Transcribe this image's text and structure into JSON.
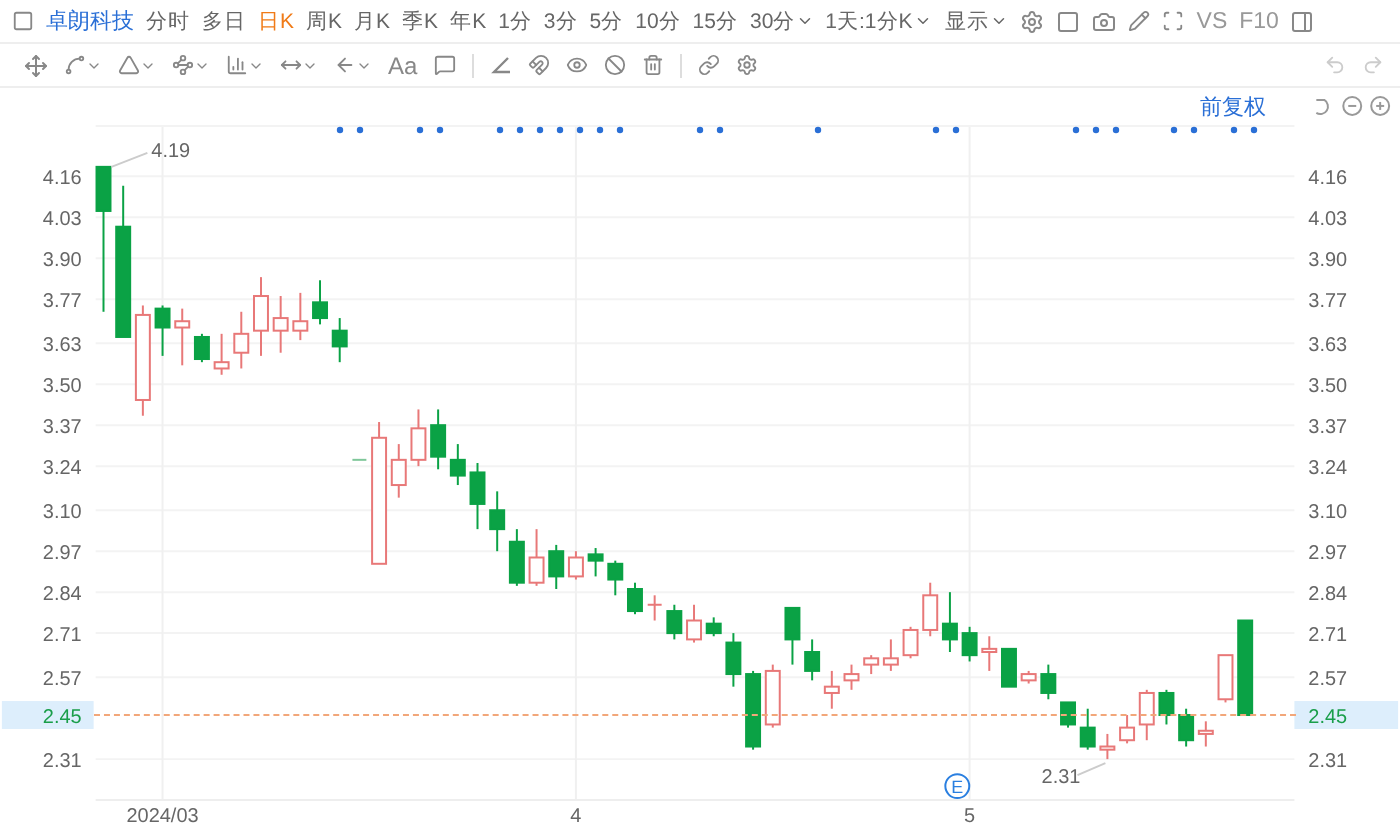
{
  "header": {
    "stock_name": "卓朗科技",
    "periods": [
      {
        "label": "分时",
        "selected": false,
        "kind": "plain"
      },
      {
        "label": "多日",
        "selected": false,
        "kind": "plain"
      },
      {
        "label": "日K",
        "selected": true,
        "kind": "plain"
      },
      {
        "label": "周K",
        "selected": false,
        "kind": "plain"
      },
      {
        "label": "月K",
        "selected": false,
        "kind": "plain"
      },
      {
        "label": "季K",
        "selected": false,
        "kind": "plain"
      },
      {
        "label": "年K",
        "selected": false,
        "kind": "plain"
      },
      {
        "label": "1分",
        "selected": false,
        "kind": "plain"
      },
      {
        "label": "3分",
        "selected": false,
        "kind": "plain"
      },
      {
        "label": "5分",
        "selected": false,
        "kind": "plain"
      },
      {
        "label": "10分",
        "selected": false,
        "kind": "plain"
      },
      {
        "label": "15分",
        "selected": false,
        "kind": "plain"
      },
      {
        "label": "30分",
        "selected": false,
        "kind": "dropdown"
      }
    ],
    "cycle_select": "1天:1分K",
    "display_menu": "显示",
    "compare": "VS",
    "f10": "F10"
  },
  "drawing_toolbar": {
    "text_tool": "Aa"
  },
  "chart": {
    "adjust_mode": "前复权",
    "left_axis": {
      "current_price": "2.45"
    },
    "right_axis": {
      "ticks": [
        "4.16",
        "4.03",
        "3.90",
        "3.77",
        "3.63",
        "3.50",
        "3.37",
        "3.24",
        "3.10",
        "2.97",
        "2.84",
        "2.71",
        "2.57",
        "2.31"
      ],
      "current_price": "2.45"
    },
    "high_label": "4.19",
    "low_label": "2.31",
    "event_marker": "E",
    "chart_data": {
      "type": "candlestick",
      "categories": [
        null,
        null,
        null,
        "2024/03",
        null,
        null,
        null,
        null,
        null,
        null,
        null,
        null,
        null,
        null,
        null,
        null,
        null,
        null,
        null,
        null,
        null,
        null,
        null,
        null,
        "4",
        null,
        null,
        null,
        null,
        null,
        null,
        null,
        null,
        null,
        null,
        null,
        null,
        null,
        null,
        null,
        null,
        null,
        null,
        null,
        "5",
        null,
        null,
        null,
        null,
        null,
        null,
        null,
        null,
        null,
        null,
        null,
        null,
        null,
        null
      ],
      "ohlc": [
        [
          4.19,
          4.19,
          3.73,
          4.05
        ],
        [
          4.0,
          4.13,
          3.65,
          3.65
        ],
        [
          3.45,
          3.75,
          3.4,
          3.72
        ],
        [
          3.74,
          3.75,
          3.59,
          3.68
        ],
        [
          3.68,
          3.74,
          3.56,
          3.7
        ],
        [
          3.65,
          3.66,
          3.57,
          3.58
        ],
        [
          3.55,
          3.66,
          3.53,
          3.57
        ],
        [
          3.6,
          3.73,
          3.55,
          3.66
        ],
        [
          3.67,
          3.84,
          3.59,
          3.78
        ],
        [
          3.67,
          3.78,
          3.6,
          3.71
        ],
        [
          3.67,
          3.79,
          3.64,
          3.7
        ],
        [
          3.76,
          3.83,
          3.69,
          3.71
        ],
        [
          3.67,
          3.71,
          3.57,
          3.62
        ],
        [
          3.26,
          3.26,
          3.26,
          3.26
        ],
        [
          2.93,
          3.38,
          2.93,
          3.33
        ],
        [
          3.18,
          3.31,
          3.14,
          3.26
        ],
        [
          3.26,
          3.42,
          3.24,
          3.36
        ],
        [
          3.37,
          3.42,
          3.23,
          3.27
        ],
        [
          3.26,
          3.31,
          3.18,
          3.21
        ],
        [
          3.22,
          3.25,
          3.04,
          3.12
        ],
        [
          3.1,
          3.16,
          2.97,
          3.04
        ],
        [
          3.0,
          3.04,
          2.86,
          2.87
        ],
        [
          2.87,
          3.04,
          2.86,
          2.95
        ],
        [
          2.97,
          2.99,
          2.85,
          2.89
        ],
        [
          2.89,
          2.97,
          2.88,
          2.95
        ],
        [
          2.96,
          2.98,
          2.89,
          2.94
        ],
        [
          2.93,
          2.94,
          2.83,
          2.88
        ],
        [
          2.85,
          2.87,
          2.77,
          2.78
        ],
        [
          2.8,
          2.83,
          2.75,
          2.8
        ],
        [
          2.78,
          2.8,
          2.69,
          2.71
        ],
        [
          2.69,
          2.8,
          2.68,
          2.75
        ],
        [
          2.74,
          2.76,
          2.7,
          2.71
        ],
        [
          2.68,
          2.71,
          2.54,
          2.58
        ],
        [
          2.58,
          2.59,
          2.34,
          2.35
        ],
        [
          2.42,
          2.61,
          2.41,
          2.59
        ],
        [
          2.79,
          2.79,
          2.61,
          2.69
        ],
        [
          2.65,
          2.69,
          2.56,
          2.59
        ],
        [
          2.52,
          2.59,
          2.47,
          2.54
        ],
        [
          2.56,
          2.61,
          2.53,
          2.58
        ],
        [
          2.61,
          2.64,
          2.58,
          2.63
        ],
        [
          2.61,
          2.69,
          2.59,
          2.63
        ],
        [
          2.64,
          2.73,
          2.63,
          2.72
        ],
        [
          2.72,
          2.87,
          2.7,
          2.83
        ],
        [
          2.74,
          2.84,
          2.65,
          2.69
        ],
        [
          2.71,
          2.73,
          2.62,
          2.64
        ],
        [
          2.65,
          2.7,
          2.59,
          2.66
        ],
        [
          2.66,
          2.66,
          2.54,
          2.54
        ],
        [
          2.56,
          2.59,
          2.55,
          2.58
        ],
        [
          2.58,
          2.61,
          2.5,
          2.52
        ],
        [
          2.49,
          2.49,
          2.41,
          2.42
        ],
        [
          2.41,
          2.47,
          2.34,
          2.35
        ],
        [
          2.34,
          2.39,
          2.31,
          2.35
        ],
        [
          2.37,
          2.45,
          2.36,
          2.41
        ],
        [
          2.42,
          2.53,
          2.37,
          2.52
        ],
        [
          2.52,
          2.53,
          2.42,
          2.45
        ],
        [
          2.45,
          2.47,
          2.35,
          2.37
        ],
        [
          2.39,
          2.43,
          2.35,
          2.4
        ],
        [
          2.5,
          2.64,
          2.49,
          2.64
        ],
        [
          2.75,
          2.75,
          2.45,
          2.45
        ]
      ],
      "ylim": [
        2.18,
        4.32
      ],
      "grid": true,
      "yticks": [
        {
          "value": 4.16,
          "label": "4.16"
        },
        {
          "value": 4.03,
          "label": "4.03"
        },
        {
          "value": 3.9,
          "label": "3.90"
        },
        {
          "value": 3.77,
          "label": "3.77"
        },
        {
          "value": 3.63,
          "label": "3.63"
        },
        {
          "value": 3.5,
          "label": "3.50"
        },
        {
          "value": 3.37,
          "label": "3.37"
        },
        {
          "value": 3.24,
          "label": "3.24"
        },
        {
          "value": 3.1,
          "label": "3.10"
        },
        {
          "value": 2.97,
          "label": "2.97"
        },
        {
          "value": 2.84,
          "label": "2.84"
        },
        {
          "value": 2.71,
          "label": "2.71"
        },
        {
          "value": 2.57,
          "label": "2.57"
        },
        {
          "value": 2.31,
          "label": "2.31"
        }
      ]
    }
  }
}
